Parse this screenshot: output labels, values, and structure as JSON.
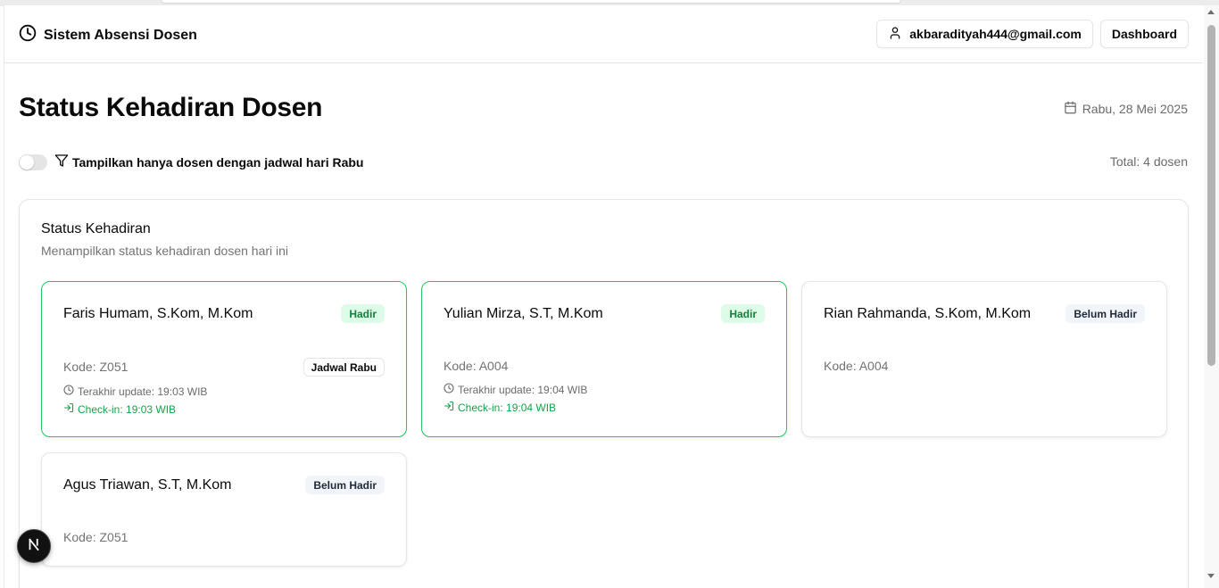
{
  "app": {
    "title": "Sistem Absensi Dosen",
    "user_email": "akbaradityah444@gmail.com",
    "dashboard_label": "Dashboard"
  },
  "page": {
    "title": "Status Kehadiran Dosen",
    "date": "Rabu, 28 Mei 2025",
    "filter_label": "Tampilkan hanya dosen dengan jadwal hari Rabu",
    "filter_enabled": false,
    "total": "Total: 4 dosen"
  },
  "card": {
    "title": "Status Kehadiran",
    "description": "Menampilkan status kehadiran dosen hari ini"
  },
  "lecturers": [
    {
      "name": "Faris Humam, S.Kom, M.Kom",
      "status": "Hadir",
      "code": "Kode: Z051",
      "day_badge": "Jadwal Rabu",
      "last_update": "Terakhir update: 19:03 WIB",
      "checkin": "Check-in: 19:03 WIB"
    },
    {
      "name": "Yulian Mirza, S.T, M.Kom",
      "status": "Hadir",
      "code": "Kode: A004",
      "last_update": "Terakhir update: 19:04 WIB",
      "checkin": "Check-in: 19:04 WIB"
    },
    {
      "name": "Rian Rahmanda, S.Kom, M.Kom",
      "status": "Belum Hadir",
      "code": "Kode: A004"
    },
    {
      "name": "Agus Triawan, S.T, M.Kom",
      "status": "Belum Hadir",
      "code": "Kode: Z051"
    }
  ],
  "icons": {
    "brand": "clock-icon",
    "user": "user-icon",
    "date": "calendar-icon",
    "filter": "filter-icon",
    "update": "clock-icon",
    "checkin": "log-in-icon",
    "next": "nextjs-logo"
  },
  "colors": {
    "present_border": "#22c55e",
    "present_badge_bg": "#dcfce7",
    "present_text": "#15803d",
    "checkin_text": "#16a34a",
    "absent_badge_bg": "#f1f5f9"
  }
}
